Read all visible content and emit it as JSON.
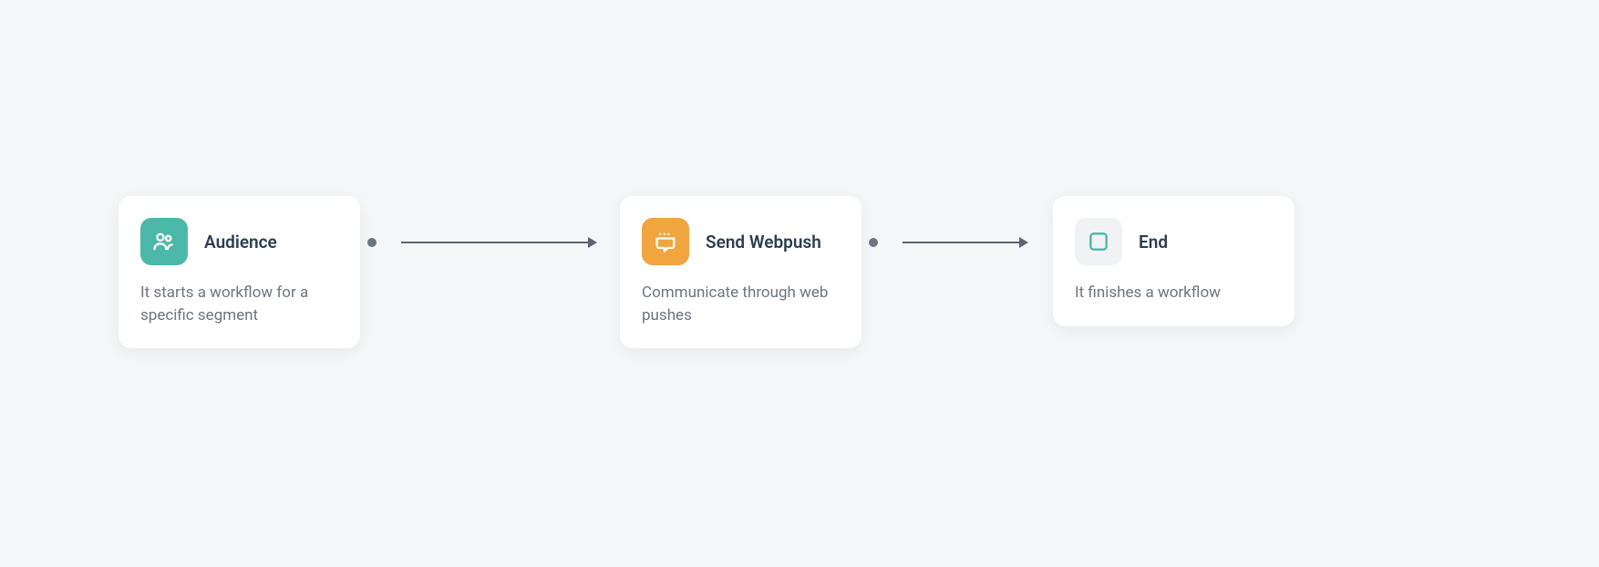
{
  "nodes": {
    "audience": {
      "title": "Audience",
      "description": "It starts a workflow for a specific segment"
    },
    "webpush": {
      "title": "Send Webpush",
      "description": "Communicate through web pushes"
    },
    "end": {
      "title": "End",
      "description": "It finishes a workflow"
    }
  },
  "colors": {
    "audience_icon_bg": "#4bb8a9",
    "webpush_icon_bg": "#f0a53f",
    "end_icon_bg": "#f1f2f4",
    "node_bg": "#ffffff",
    "page_bg": "#f5f6f7"
  }
}
